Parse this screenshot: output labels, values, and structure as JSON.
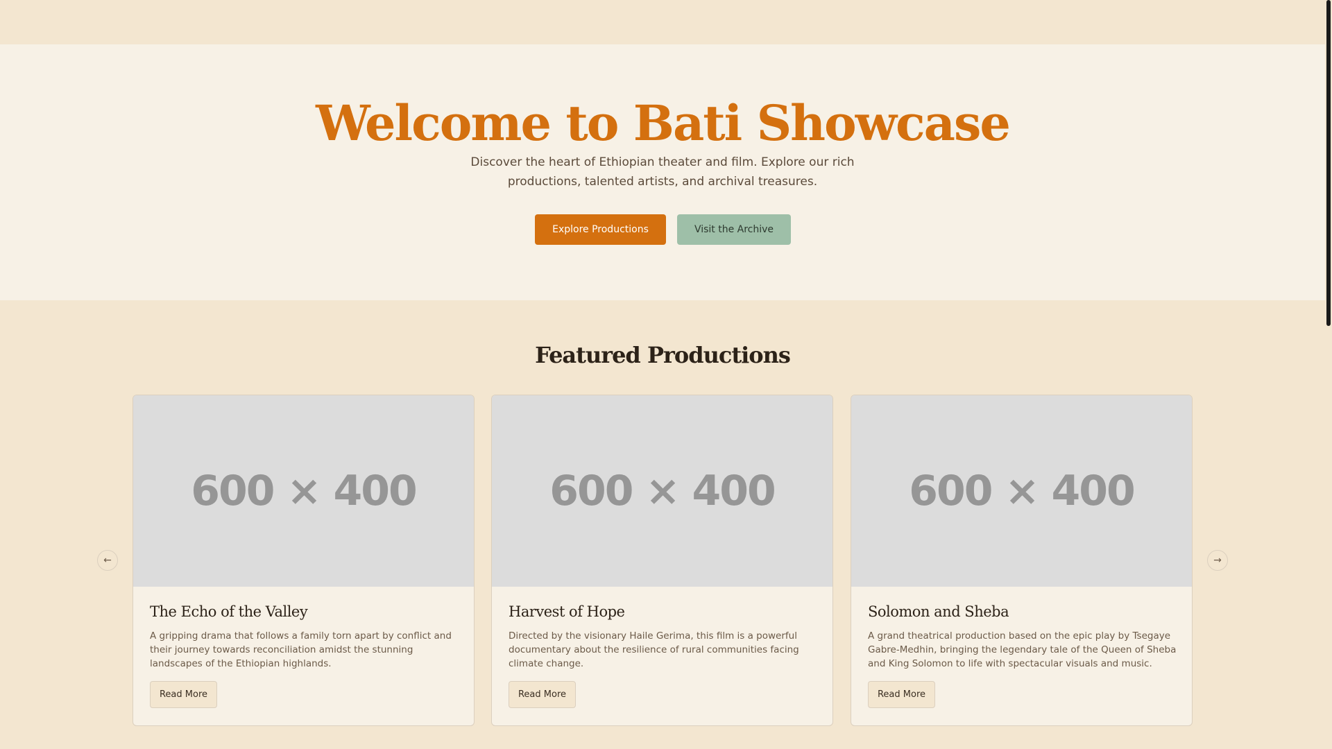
{
  "hero": {
    "title": "Welcome to Bati Showcase",
    "subtitle": "Discover the heart of Ethiopian theater and film. Explore our rich productions, talented artists, and archival treasures.",
    "primary_button": "Explore Productions",
    "secondary_button": "Visit the Archive"
  },
  "featured": {
    "title": "Featured Productions",
    "cards": [
      {
        "image_text": "600 × 400",
        "title": "The Echo of the Valley",
        "description": "A gripping drama that follows a family torn apart by conflict and their journey towards reconciliation amidst the stunning landscapes of the Ethiopian highlands.",
        "button": "Read More"
      },
      {
        "image_text": "600 × 400",
        "title": "Harvest of Hope",
        "description": "Directed by the visionary Haile Gerima, this film is a powerful documentary about the resilience of rural communities facing climate change.",
        "button": "Read More"
      },
      {
        "image_text": "600 × 400",
        "title": "Solomon and Sheba",
        "description": "A grand theatrical production based on the epic play by Tsegaye Gabre-Medhin, bringing the legendary tale of the Queen of Sheba and King Solomon to life with spectacular visuals and music.",
        "button": "Read More"
      }
    ],
    "prev_icon": "arrow-left-icon",
    "next_icon": "arrow-right-icon"
  },
  "colors": {
    "accent": "#d4700f",
    "secondary": "#9ebfa8",
    "background": "#f3e6d0",
    "hero_background": "#f7f1e6"
  }
}
